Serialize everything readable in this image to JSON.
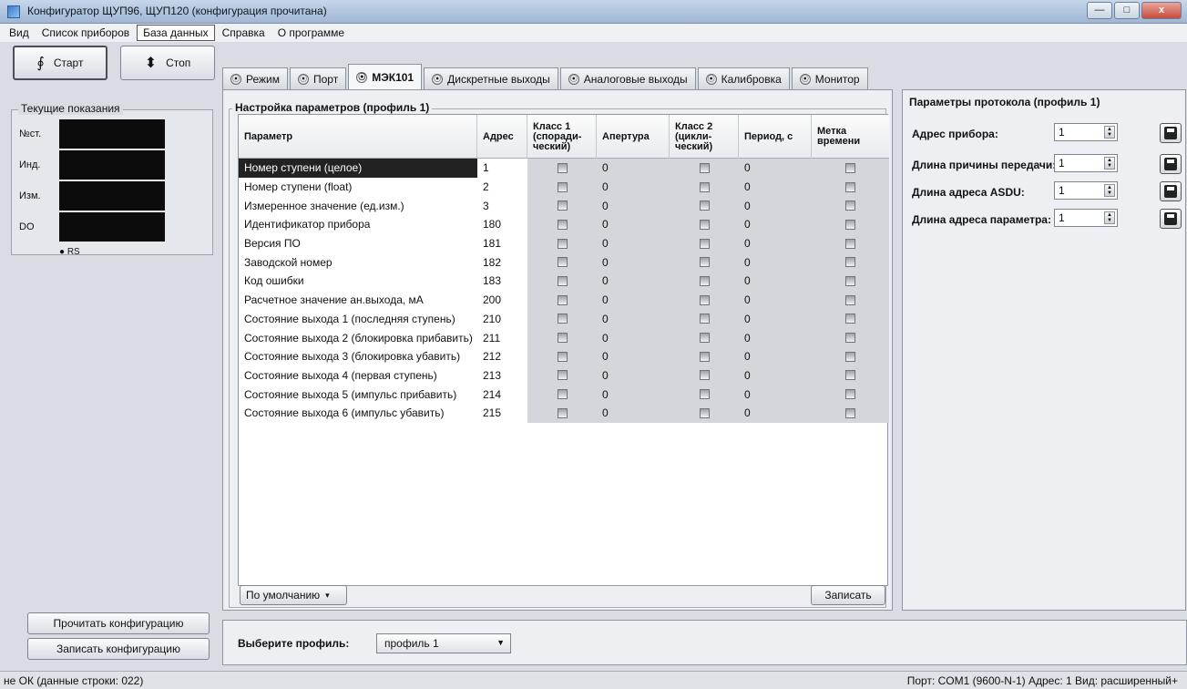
{
  "window": {
    "title": "Конфигуратор ЩУП96, ЩУП120 (конфигурация прочитана)",
    "buttons": {
      "minimize": "—",
      "maximize": "□",
      "close": "x"
    }
  },
  "menu": [
    "Вид",
    "Список приборов",
    "База данных",
    "Справка",
    "О программе"
  ],
  "left": {
    "start_label": "Старт",
    "stop_label": "Стоп",
    "readings_title": "Текущие показания",
    "readings": [
      "№ст.",
      "Инд.",
      "Изм.",
      "DO"
    ],
    "rs_label": "RS",
    "read_config": "Прочитать конфигурацию",
    "write_config": "Записать конфигурацию"
  },
  "tabs": [
    {
      "label": "Режим"
    },
    {
      "label": "Порт"
    },
    {
      "label": "МЭК101"
    },
    {
      "label": "Дискретные выходы"
    },
    {
      "label": "Аналоговые выходы"
    },
    {
      "label": "Калибровка"
    },
    {
      "label": "Монитор"
    }
  ],
  "params": {
    "group_title": "Настройка параметров (профиль 1)",
    "headers": {
      "param": "Параметр",
      "addr": "Адрес",
      "k1_line1": "Класс 1",
      "k1_line2": "(споради-",
      "k1_line3": "ческий)",
      "apert": "Апертура",
      "k2_line1": "Класс 2",
      "k2_line2": "(цикли-",
      "k2_line3": "ческий)",
      "period": "Период, с",
      "mark_line1": "Метка",
      "mark_line2": "времени"
    },
    "rows": [
      {
        "name": "Номер ступени (целое)",
        "addr": "1",
        "apert": "0",
        "period": "0"
      },
      {
        "name": "Номер ступени (float)",
        "addr": "2",
        "apert": "0",
        "period": "0"
      },
      {
        "name": "Измеренное значение (ед.изм.)",
        "addr": "3",
        "apert": "0",
        "period": "0"
      },
      {
        "name": "Идентификатор прибора",
        "addr": "180",
        "apert": "0",
        "period": "0"
      },
      {
        "name": "Версия ПО",
        "addr": "181",
        "apert": "0",
        "period": "0"
      },
      {
        "name": "Заводской номер",
        "addr": "182",
        "apert": "0",
        "period": "0"
      },
      {
        "name": "Код ошибки",
        "addr": "183",
        "apert": "0",
        "period": "0"
      },
      {
        "name": "Расчетное значение ан.выхода, мА",
        "addr": "200",
        "apert": "0",
        "period": "0"
      },
      {
        "name": "Состояние выхода 1 (последняя ступень)",
        "addr": "210",
        "apert": "0",
        "period": "0"
      },
      {
        "name": "Состояние выхода 2 (блокировка прибавить)",
        "addr": "211",
        "apert": "0",
        "period": "0"
      },
      {
        "name": "Состояние выхода 3 (блокировка убавить)",
        "addr": "212",
        "apert": "0",
        "period": "0"
      },
      {
        "name": "Состояние выхода 4 (первая ступень)",
        "addr": "213",
        "apert": "0",
        "period": "0"
      },
      {
        "name": "Состояние выхода 5 (импульс прибавить)",
        "addr": "214",
        "apert": "0",
        "period": "0"
      },
      {
        "name": "Состояние выхода 6 (импульс убавить)",
        "addr": "215",
        "apert": "0",
        "period": "0"
      }
    ],
    "default_btn": "По умолчанию",
    "save_btn": "Записать"
  },
  "protocol": {
    "group_title": "Параметры протокола (профиль 1)",
    "rows": [
      {
        "label": "Адрес прибора:",
        "value": "1"
      },
      {
        "label": "Длина причины передачи:",
        "value": "1"
      },
      {
        "label": "Длина адреса ASDU:",
        "value": "1"
      },
      {
        "label": "Длина адреса параметра:",
        "value": "1"
      }
    ]
  },
  "profile": {
    "label": "Выберите профиль:",
    "selected": "профиль 1"
  },
  "status": {
    "left": "не ОК (данные строки: 022)",
    "right": "Порт: COM1 (9600-N-1)   Адрес: 1   Вид: расширенный+"
  }
}
